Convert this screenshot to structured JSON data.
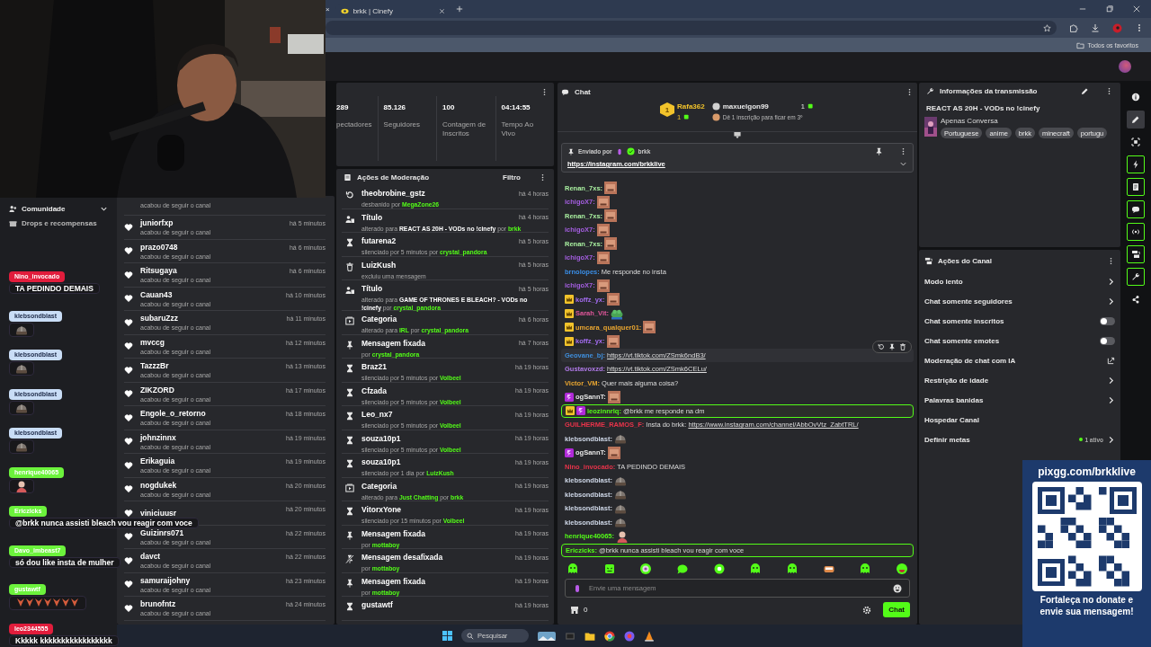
{
  "browser": {
    "prev_tab_close": "×",
    "tab": {
      "title": "brkk | Cinefy"
    },
    "bookmarks": "Todos os favoritos"
  },
  "stats": [
    {
      "value": "289",
      "label": "pectadores"
    },
    {
      "value": "85.126",
      "label": "Seguidores"
    },
    {
      "value": "100",
      "label": "Contagem de Inscritos"
    },
    {
      "value": "04:14:55",
      "label": "Tempo Ao Vivo"
    }
  ],
  "followers": {
    "items": [
      {
        "subtitle": "acabou de seguir o canal"
      },
      {
        "name": "juniorfxp",
        "subtitle": "acabou de seguir o canal",
        "time": "há 5 minutos"
      },
      {
        "name": "prazo0748",
        "subtitle": "acabou de seguir o canal",
        "time": "há 6 minutos"
      },
      {
        "name": "Ritsugaya",
        "subtitle": "acabou de seguir o canal",
        "time": "há 6 minutos"
      },
      {
        "name": "Cauan43",
        "subtitle": "acabou de seguir o canal",
        "time": "há 10 minutos"
      },
      {
        "name": "subaruZzz",
        "subtitle": "acabou de seguir o canal",
        "time": "há 11 minutos"
      },
      {
        "name": "mvccg",
        "subtitle": "acabou de seguir o canal",
        "time": "há 12 minutos"
      },
      {
        "name": "TazzzBr",
        "subtitle": "acabou de seguir o canal",
        "time": "há 13 minutos"
      },
      {
        "name": "ZIKZORD",
        "subtitle": "acabou de seguir o canal",
        "time": "há 17 minutos"
      },
      {
        "name": "Engole_o_retorno",
        "subtitle": "acabou de seguir o canal",
        "time": "há 18 minutos"
      },
      {
        "name": "johnzinnx",
        "subtitle": "acabou de seguir o canal",
        "time": "há 19 minutos"
      },
      {
        "name": "Erikaguia",
        "subtitle": "acabou de seguir o canal",
        "time": "há 19 minutos"
      },
      {
        "name": "nogdukek",
        "subtitle": "acabou de seguir o canal",
        "time": "há 20 minutos"
      },
      {
        "name": "viniciuusr",
        "time": "há 20 minutos"
      },
      {
        "name": "Guizinrs071",
        "subtitle": "acabou de seguir o canal",
        "time": "há 22 minutos"
      },
      {
        "name": "davct",
        "subtitle": "acabou de seguir o canal",
        "time": "há 22 minutos"
      },
      {
        "name": "samuraijohny",
        "subtitle": "acabou de seguir o canal",
        "time": "há 23 minutos"
      },
      {
        "name": "brunofntz",
        "subtitle": "acabou de seguir o canal",
        "time": "há 24 minutos"
      }
    ]
  },
  "moderation": {
    "title": "Ações de Moderação",
    "filter": "Filtro",
    "items": [
      {
        "kind": "unban",
        "title": "theobrobine_gstz",
        "time": "há 4 horas",
        "detail": [
          {
            "kind": "plain",
            "text": "desbanido por "
          },
          {
            "kind": "user",
            "text": "MegaZone26"
          }
        ]
      },
      {
        "kind": "title",
        "title": "Título",
        "time": "há 4 horas",
        "detail": [
          {
            "kind": "plain",
            "text": "alterado para "
          },
          {
            "kind": "value",
            "text": "REACT AS 20H - VODs no !cinefy"
          },
          {
            "kind": "plain",
            "text": " por "
          },
          {
            "kind": "user",
            "text": "brkk"
          }
        ]
      },
      {
        "kind": "timeout",
        "title": "futarena2",
        "time": "há 5 horas",
        "detail": [
          {
            "kind": "plain",
            "text": "silenciado por 5 minutos por "
          },
          {
            "kind": "user",
            "text": "crystal_pandora"
          }
        ]
      },
      {
        "kind": "delete",
        "title": "LuizKush",
        "time": "há 5 horas",
        "detail": [
          {
            "kind": "plain",
            "text": "excluiu uma mensagem"
          }
        ]
      },
      {
        "kind": "title",
        "title": "Título",
        "time": "há 5 horas",
        "detail": [
          {
            "kind": "plain",
            "text": "alterado para "
          },
          {
            "kind": "value",
            "text": "GAME OF THRONES E BLEACH? - VODs no !cinefy"
          },
          {
            "kind": "plain",
            "text": " por "
          },
          {
            "kind": "user",
            "text": "crystal_pandora"
          }
        ]
      },
      {
        "kind": "category",
        "title": "Categoria",
        "time": "há 6 horas",
        "detail": [
          {
            "kind": "plain",
            "text": "alterado para "
          },
          {
            "kind": "user",
            "text": "IRL"
          },
          {
            "kind": "plain",
            "text": " por "
          },
          {
            "kind": "user",
            "text": "crystal_pandora"
          }
        ]
      },
      {
        "kind": "pin",
        "title": "Mensagem fixada",
        "time": "há 7 horas",
        "detail": [
          {
            "kind": "plain",
            "text": "por "
          },
          {
            "kind": "user",
            "text": "crystal_pandora"
          }
        ]
      },
      {
        "kind": "timeout",
        "title": "Braz21",
        "time": "há 19 horas",
        "detail": [
          {
            "kind": "plain",
            "text": "silenciado por 5 minutos por "
          },
          {
            "kind": "user",
            "text": "Volbeel"
          }
        ]
      },
      {
        "kind": "timeout",
        "title": "Cfzada",
        "time": "há 19 horas",
        "detail": [
          {
            "kind": "plain",
            "text": "silenciado por 5 minutos por "
          },
          {
            "kind": "user",
            "text": "Volbeel"
          }
        ]
      },
      {
        "kind": "timeout",
        "title": "Leo_nx7",
        "time": "há 19 horas",
        "detail": [
          {
            "kind": "plain",
            "text": "silenciado por 5 minutos por "
          },
          {
            "kind": "user",
            "text": "Volbeel"
          }
        ]
      },
      {
        "kind": "timeout",
        "title": "souza10p1",
        "time": "há 19 horas",
        "detail": [
          {
            "kind": "plain",
            "text": "silenciado por 5 minutos por "
          },
          {
            "kind": "user",
            "text": "Volbeel"
          }
        ]
      },
      {
        "kind": "timeout",
        "title": "souza10p1",
        "time": "há 19 horas",
        "detail": [
          {
            "kind": "plain",
            "text": "silenciado por 1 dia por "
          },
          {
            "kind": "user",
            "text": "LuizKush"
          }
        ]
      },
      {
        "kind": "category",
        "title": "Categoria",
        "time": "há 19 horas",
        "detail": [
          {
            "kind": "plain",
            "text": "alterado para "
          },
          {
            "kind": "user",
            "text": "Just Chatting"
          },
          {
            "kind": "plain",
            "text": " por "
          },
          {
            "kind": "user",
            "text": "brkk"
          }
        ]
      },
      {
        "kind": "timeout",
        "title": "VitorxYone",
        "time": "há 19 horas",
        "detail": [
          {
            "kind": "plain",
            "text": "silenciado por 15 minutos por "
          },
          {
            "kind": "user",
            "text": "Volbeel"
          }
        ]
      },
      {
        "kind": "pin",
        "title": "Mensagem fixada",
        "time": "há 19 horas",
        "detail": [
          {
            "kind": "plain",
            "text": "por "
          },
          {
            "kind": "user",
            "text": "mottaboy"
          }
        ]
      },
      {
        "kind": "unpin",
        "title": "Mensagem desafixada",
        "time": "há 19 horas",
        "detail": [
          {
            "kind": "plain",
            "text": "por "
          },
          {
            "kind": "user",
            "text": "mottaboy"
          }
        ]
      },
      {
        "kind": "pin",
        "title": "Mensagem fixada",
        "time": "há 19 horas",
        "detail": [
          {
            "kind": "plain",
            "text": "por "
          },
          {
            "kind": "user",
            "text": "mottaboy"
          }
        ]
      },
      {
        "kind": "timeout",
        "title": "gustawtf",
        "time": "há 19 horas"
      }
    ]
  },
  "chat": {
    "title": "Chat",
    "leaderboard": [
      {
        "rank": "1",
        "name": "Rafa362",
        "count": "1"
      },
      {
        "name": "maxuelgon99",
        "count": "1"
      }
    ],
    "leader_hint": "Dê 1 inscrição para ficar em 3º",
    "pinned": {
      "label": "Enviado por",
      "user": "brkk",
      "link": "https://instagram.com/brkklive"
    },
    "messages": [
      {
        "user": "Renan_7xs:",
        "color": "#a9f0a0",
        "emote": {
          "kind": "face"
        }
      },
      {
        "user": "ichigoX7:",
        "color": "#a45ee0",
        "emote": {
          "kind": "face"
        }
      },
      {
        "user": "Renan_7xs:",
        "color": "#a9f0a0",
        "emote": {
          "kind": "face"
        }
      },
      {
        "user": "ichigoX7:",
        "color": "#a45ee0",
        "emote": {
          "kind": "face"
        }
      },
      {
        "user": "Renan_7xs:",
        "color": "#a9f0a0",
        "emote": {
          "kind": "face"
        }
      },
      {
        "user": "ichigoX7:",
        "color": "#a45ee0",
        "emote": {
          "kind": "face"
        }
      },
      {
        "user": "brnolopes:",
        "color": "#3a8ee6",
        "text": "Me responde no insta"
      },
      {
        "user": "ichigoX7:",
        "color": "#a45ee0",
        "emote": {
          "kind": "face"
        }
      },
      {
        "user": "koffz_yx:",
        "color": "#a36cf0",
        "badges": [
          {
            "kind": "crown"
          }
        ],
        "emote": {
          "kind": "face"
        }
      },
      {
        "user": "Sarah_Vit:",
        "color": "#e0569a",
        "badges": [
          {
            "kind": "crown"
          }
        ],
        "emote": {
          "kind": "frog"
        }
      },
      {
        "user": "umcara_qualquer01:",
        "color": "#e8a530",
        "badges": [
          {
            "kind": "crown"
          }
        ],
        "emote": {
          "kind": "face"
        }
      },
      {
        "user": "koffz_yx:",
        "color": "#a36cf0",
        "badges": [
          {
            "kind": "crown"
          }
        ],
        "emote": {
          "kind": "face"
        }
      },
      {
        "user": "Geovane_bj:",
        "color": "#3f8fdd",
        "link": "https://vt.tiktok.com/ZSmk6ndB3/",
        "hovered": true
      },
      {
        "user": "Gustavoxzd:",
        "color": "#b07ae8",
        "link": "https://vt.tiktok.com/ZSmk6CELu/"
      },
      {
        "user": "Victor_VM:",
        "color": "#e8a530",
        "text": "Quer mais alguma coisa?"
      },
      {
        "user": "ogSannT:",
        "color": "#e6e6e6",
        "badges": [
          {
            "kind": "sub"
          }
        ],
        "emote": {
          "kind": "face"
        }
      },
      {
        "user": "leozinnrlq:",
        "color": "#53fc18",
        "badges": [
          {
            "kind": "crown"
          },
          {
            "kind": "sub"
          }
        ],
        "text": "@brkk me responde na dm",
        "highlighted": true
      },
      {
        "user": "GUILHERME_RAMOS_F:",
        "color": "#e8334a",
        "text": "Insta do brkk:",
        "link": "https://www.instagram.com/channel/AbbOvVtz_ZabtTRL/"
      },
      {
        "user": "klebsondblast:",
        "color": "#cfd8e8",
        "emote": {
          "kind": "helmet"
        }
      },
      {
        "user": "ogSannT:",
        "color": "#e6e6e6",
        "badges": [
          {
            "kind": "sub"
          }
        ],
        "emote": {
          "kind": "face"
        }
      },
      {
        "user": "Nino_invocado:",
        "color": "#e8334a",
        "text": "TA PEDINDO DEMAIS"
      },
      {
        "user": "klebsondblast:",
        "color": "#cfd8e8",
        "emote": {
          "kind": "helmet"
        }
      },
      {
        "user": "klebsondblast:",
        "color": "#cfd8e8",
        "emote": {
          "kind": "helmet"
        }
      },
      {
        "user": "klebsondblast:",
        "color": "#cfd8e8",
        "emote": {
          "kind": "helmet"
        }
      },
      {
        "user": "klebsondblast:",
        "color": "#cfd8e8",
        "emote": {
          "kind": "helmet"
        }
      },
      {
        "user": "henrique40065:",
        "color": "#53fc18",
        "emote": {
          "kind": "person"
        }
      },
      {
        "user": "Ericzicks:",
        "color": "#53fc18",
        "text": "@brkk nunca assisti bleach vou reagir com voce",
        "highlighted": true
      }
    ],
    "quick_emotes": [
      {
        "kind": "blob"
      },
      {
        "kind": "box"
      },
      {
        "kind": "ring"
      },
      {
        "kind": "chat"
      },
      {
        "kind": "orb"
      },
      {
        "kind": "blob"
      },
      {
        "kind": "blob"
      },
      {
        "kind": "tub"
      },
      {
        "kind": "blob"
      },
      {
        "kind": "grin"
      }
    ],
    "input": {
      "placeholder": "Envie uma mensagem"
    },
    "points": "0",
    "send": "Chat"
  },
  "stream_info": {
    "title": "Informações da transmissão",
    "stream_title": "REACT AS 20H - VODs no !cinefy",
    "category": "Apenas Conversa",
    "tags": [
      "Portuguese",
      "anime",
      "brkk",
      "minecraft",
      "portugu"
    ]
  },
  "channel_actions": {
    "title": "Ações do Canal",
    "items": [
      {
        "kind": "link",
        "label": "Modo lento"
      },
      {
        "kind": "link",
        "label": "Chat somente seguidores"
      },
      {
        "kind": "toggle",
        "label": "Chat somente inscritos",
        "on": false
      },
      {
        "kind": "toggle",
        "label": "Chat somente emotes",
        "on": false
      },
      {
        "kind": "external",
        "label": "Moderação de chat com IA"
      },
      {
        "kind": "link",
        "label": "Restrição de idade"
      },
      {
        "kind": "link",
        "label": "Palavras banidas"
      },
      {
        "kind": "plain",
        "label": "Hospedar Canal"
      },
      {
        "kind": "goal",
        "label": "Definir metas",
        "status": "1 ativo"
      }
    ]
  },
  "rail": [
    {
      "kind": "info",
      "active": false
    },
    {
      "kind": "pencil",
      "active": false,
      "selected": true
    },
    {
      "kind": "focus",
      "active": false
    },
    {
      "kind": "bolt",
      "active": true
    },
    {
      "kind": "note",
      "active": true
    },
    {
      "kind": "chat",
      "active": true
    },
    {
      "kind": "broadcast",
      "active": true
    },
    {
      "kind": "layout",
      "active": true
    },
    {
      "kind": "wrench",
      "active": true
    },
    {
      "kind": "share",
      "active": false
    }
  ],
  "overlay": {
    "menu": [
      {
        "kind": "community",
        "label": "Comunidade"
      },
      {
        "kind": "drops",
        "label": "Drops e recompensas"
      }
    ],
    "messages": [
      {
        "name": "Nino_invocado",
        "color": "#e11d3c",
        "text": "TA PEDINDO DEMAIS"
      },
      {
        "name": "klebsondblast",
        "color": "#c9ddf6",
        "emote": {
          "kind": "helmet"
        }
      },
      {
        "name": "klebsondblast",
        "color": "#c9ddf6",
        "emote": {
          "kind": "helmet"
        }
      },
      {
        "name": "klebsondblast",
        "color": "#c9ddf6",
        "emote": {
          "kind": "helmet"
        }
      },
      {
        "name": "klebsondblast",
        "color": "#c9ddf6",
        "emote": {
          "kind": "helmet"
        }
      },
      {
        "name": "henrique40065",
        "color": "#6cf33c",
        "emote": {
          "kind": "person"
        }
      },
      {
        "name": "Ericzicks",
        "color": "#6cf33c",
        "text": "@brkk nunca assisti bleach vou reagir com voce"
      },
      {
        "name": "Davo_imbeast7",
        "color": "#6cf33c",
        "text": "só dou like insta de mulher"
      },
      {
        "name": "gustawtf",
        "color": "#6cf33c",
        "emote": {
          "kind": "row"
        }
      },
      {
        "name": "leo2344555",
        "color": "#e11d3c",
        "text": "Kkkkk kkkkkkkkkkkkkkkkk"
      }
    ]
  },
  "donate": {
    "url": "pixgg.com/brkklive",
    "message": "Fortaleça no donate e envie sua mensagem!"
  },
  "taskbar": {
    "search": "Pesquisar"
  }
}
